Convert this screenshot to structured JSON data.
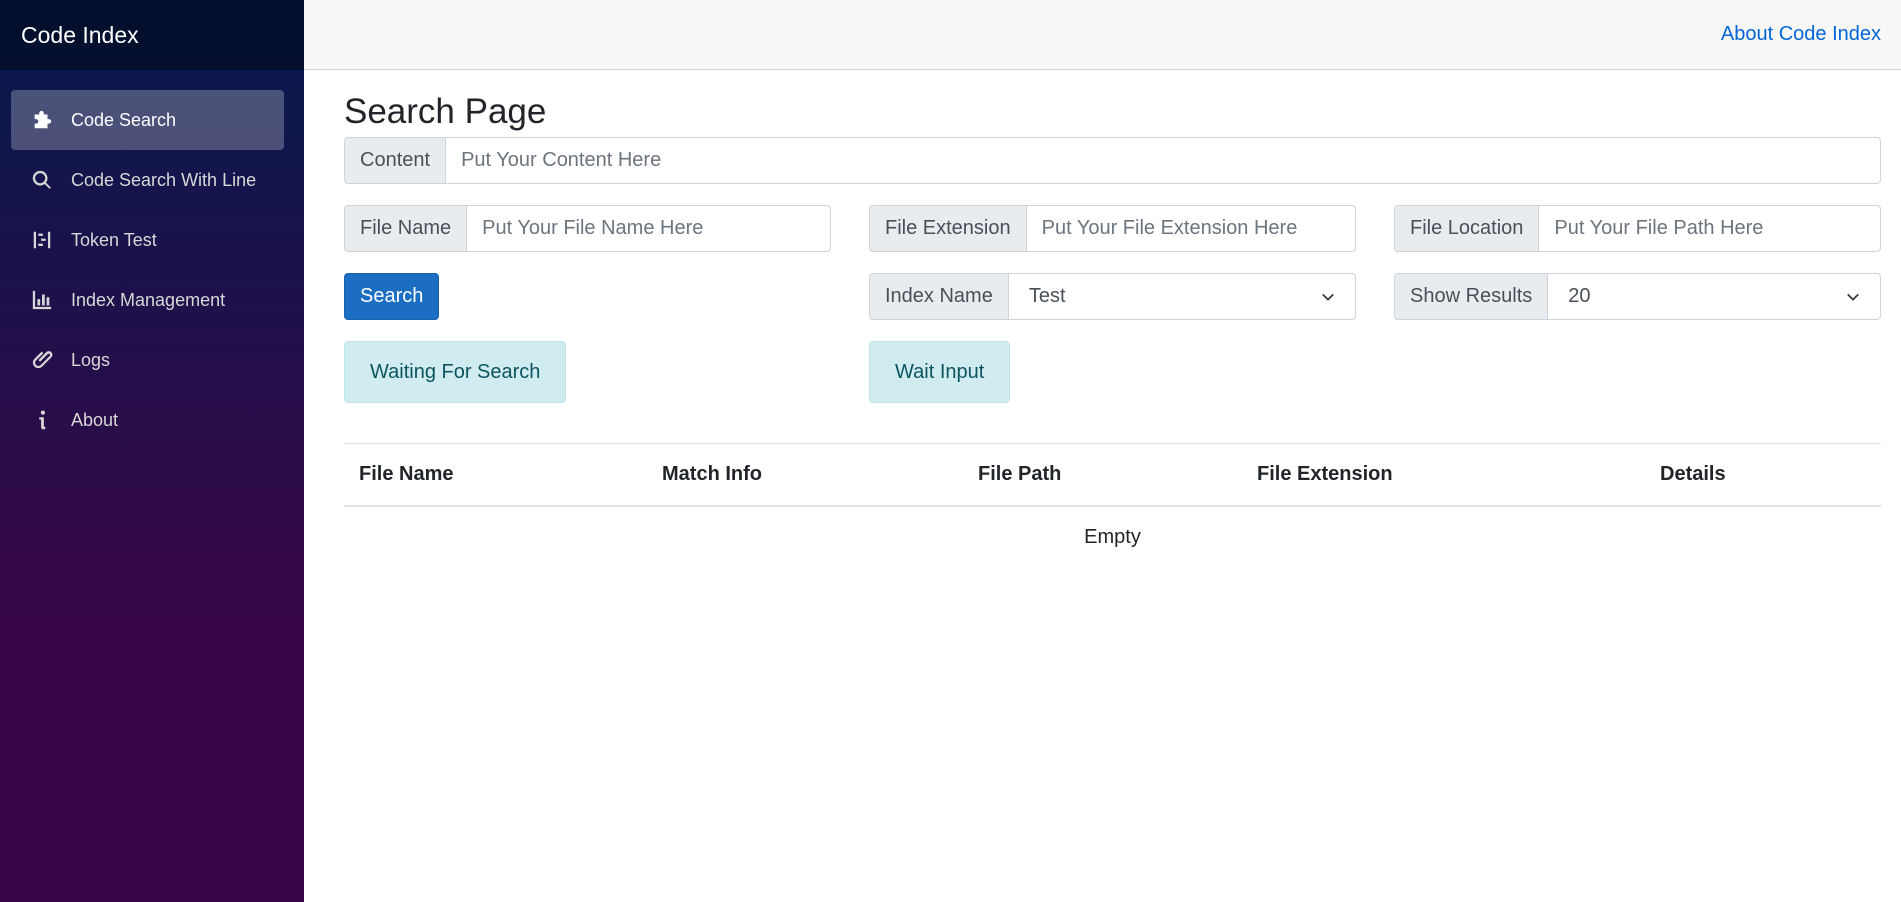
{
  "sidebar": {
    "brand": "Code Index",
    "items": [
      {
        "label": "Code Search",
        "icon": "puzzle-icon",
        "active": true
      },
      {
        "label": "Code Search With Line",
        "icon": "search-icon"
      },
      {
        "label": "Token Test",
        "icon": "token-icon"
      },
      {
        "label": "Index Management",
        "icon": "bar-chart-icon"
      },
      {
        "label": "Logs",
        "icon": "paperclip-icon"
      },
      {
        "label": "About",
        "icon": "info-icon"
      }
    ]
  },
  "topbar": {
    "about_link": "About Code Index"
  },
  "main": {
    "title": "Search Page",
    "content": {
      "label": "Content",
      "placeholder": "Put Your Content Here"
    },
    "file_name": {
      "label": "File Name",
      "placeholder": "Put Your File Name Here"
    },
    "file_extension": {
      "label": "File Extension",
      "placeholder": "Put Your File Extension Here"
    },
    "file_location": {
      "label": "File Location",
      "placeholder": "Put Your File Path Here"
    },
    "search_button": "Search",
    "index_name": {
      "label": "Index Name",
      "value": "Test"
    },
    "show_results": {
      "label": "Show Results",
      "value": "20"
    },
    "status_search": "Waiting For Search",
    "status_input": "Wait Input",
    "table": {
      "columns": [
        "File Name",
        "Match Info",
        "File Path",
        "File Extension",
        "Details"
      ],
      "empty_text": "Empty"
    }
  },
  "colors": {
    "sidebar_top": "#051b4e",
    "sidebar_bottom": "#3a0647",
    "primary": "#1b6ec2",
    "link": "#0366d6",
    "alert_info_bg": "#d1ecf1"
  }
}
